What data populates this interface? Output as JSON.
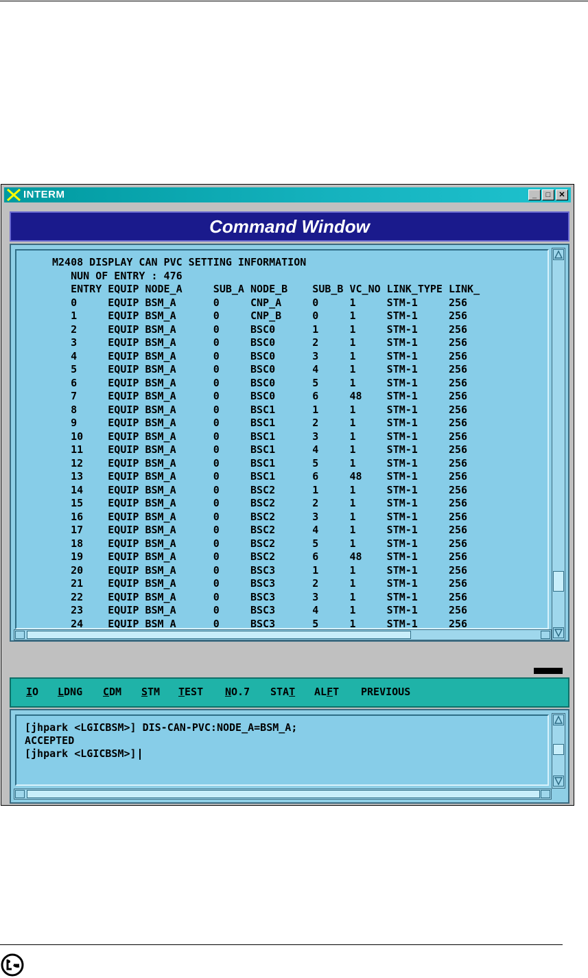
{
  "window": {
    "title": "INTERM",
    "controls": [
      "_",
      "□",
      "✕"
    ],
    "header": "Command Window"
  },
  "output": {
    "title_line": "M2408 DISPLAY CAN PVC SETTING INFORMATION",
    "count_line": "NUN OF ENTRY : 476",
    "columns": [
      "ENTRY",
      "EQUIP",
      "NODE_A",
      "SUB_A",
      "NODE_B",
      "SUB_B",
      "VC_NO",
      "LINK_TYPE",
      "LINK_"
    ],
    "rows": [
      [
        "0",
        "EQUIP",
        "BSM_A",
        "0",
        "CNP_A",
        "0",
        "1",
        "STM-1",
        "256"
      ],
      [
        "1",
        "EQUIP",
        "BSM_A",
        "0",
        "CNP_B",
        "0",
        "1",
        "STM-1",
        "256"
      ],
      [
        "2",
        "EQUIP",
        "BSM_A",
        "0",
        "BSC0",
        "1",
        "1",
        "STM-1",
        "256"
      ],
      [
        "3",
        "EQUIP",
        "BSM_A",
        "0",
        "BSC0",
        "2",
        "1",
        "STM-1",
        "256"
      ],
      [
        "4",
        "EQUIP",
        "BSM_A",
        "0",
        "BSC0",
        "3",
        "1",
        "STM-1",
        "256"
      ],
      [
        "5",
        "EQUIP",
        "BSM_A",
        "0",
        "BSC0",
        "4",
        "1",
        "STM-1",
        "256"
      ],
      [
        "6",
        "EQUIP",
        "BSM_A",
        "0",
        "BSC0",
        "5",
        "1",
        "STM-1",
        "256"
      ],
      [
        "7",
        "EQUIP",
        "BSM_A",
        "0",
        "BSC0",
        "6",
        "48",
        "STM-1",
        "256"
      ],
      [
        "8",
        "EQUIP",
        "BSM_A",
        "0",
        "BSC1",
        "1",
        "1",
        "STM-1",
        "256"
      ],
      [
        "9",
        "EQUIP",
        "BSM_A",
        "0",
        "BSC1",
        "2",
        "1",
        "STM-1",
        "256"
      ],
      [
        "10",
        "EQUIP",
        "BSM_A",
        "0",
        "BSC1",
        "3",
        "1",
        "STM-1",
        "256"
      ],
      [
        "11",
        "EQUIP",
        "BSM_A",
        "0",
        "BSC1",
        "4",
        "1",
        "STM-1",
        "256"
      ],
      [
        "12",
        "EQUIP",
        "BSM_A",
        "0",
        "BSC1",
        "5",
        "1",
        "STM-1",
        "256"
      ],
      [
        "13",
        "EQUIP",
        "BSM_A",
        "0",
        "BSC1",
        "6",
        "48",
        "STM-1",
        "256"
      ],
      [
        "14",
        "EQUIP",
        "BSM_A",
        "0",
        "BSC2",
        "1",
        "1",
        "STM-1",
        "256"
      ],
      [
        "15",
        "EQUIP",
        "BSM_A",
        "0",
        "BSC2",
        "2",
        "1",
        "STM-1",
        "256"
      ],
      [
        "16",
        "EQUIP",
        "BSM_A",
        "0",
        "BSC2",
        "3",
        "1",
        "STM-1",
        "256"
      ],
      [
        "17",
        "EQUIP",
        "BSM_A",
        "0",
        "BSC2",
        "4",
        "1",
        "STM-1",
        "256"
      ],
      [
        "18",
        "EQUIP",
        "BSM_A",
        "0",
        "BSC2",
        "5",
        "1",
        "STM-1",
        "256"
      ],
      [
        "19",
        "EQUIP",
        "BSM_A",
        "0",
        "BSC2",
        "6",
        "48",
        "STM-1",
        "256"
      ],
      [
        "20",
        "EQUIP",
        "BSM_A",
        "0",
        "BSC3",
        "1",
        "1",
        "STM-1",
        "256"
      ],
      [
        "21",
        "EQUIP",
        "BSM_A",
        "0",
        "BSC3",
        "2",
        "1",
        "STM-1",
        "256"
      ],
      [
        "22",
        "EQUIP",
        "BSM_A",
        "0",
        "BSC3",
        "3",
        "1",
        "STM-1",
        "256"
      ],
      [
        "23",
        "EQUIP",
        "BSM_A",
        "0",
        "BSC3",
        "4",
        "1",
        "STM-1",
        "256"
      ],
      [
        "24",
        "EQUIP",
        "BSM_A",
        "0",
        "BSC3",
        "5",
        "1",
        "STM-1",
        "256"
      ]
    ]
  },
  "menu": {
    "items": [
      {
        "pre": "",
        "ul": "I",
        "post": "O"
      },
      {
        "pre": "",
        "ul": "L",
        "post": "DNG"
      },
      {
        "pre": "",
        "ul": "C",
        "post": "DM"
      },
      {
        "pre": "",
        "ul": "S",
        "post": "TM"
      },
      {
        "pre": "",
        "ul": "T",
        "post": "EST"
      },
      {
        "pre": "",
        "ul": "N",
        "post": "O.7"
      },
      {
        "pre": "STA",
        "ul": "T",
        "post": ""
      },
      {
        "pre": "AL",
        "ul": "F",
        "post": "T"
      },
      {
        "pre": "PREVIOUS",
        "ul": "",
        "post": ""
      }
    ]
  },
  "terminal": {
    "lines": [
      "[jhpark <LGICBSM>] DIS-CAN-PVC:NODE_A=BSM_A;",
      "ACCEPTED",
      "[jhpark <LGICBSM>]"
    ]
  }
}
